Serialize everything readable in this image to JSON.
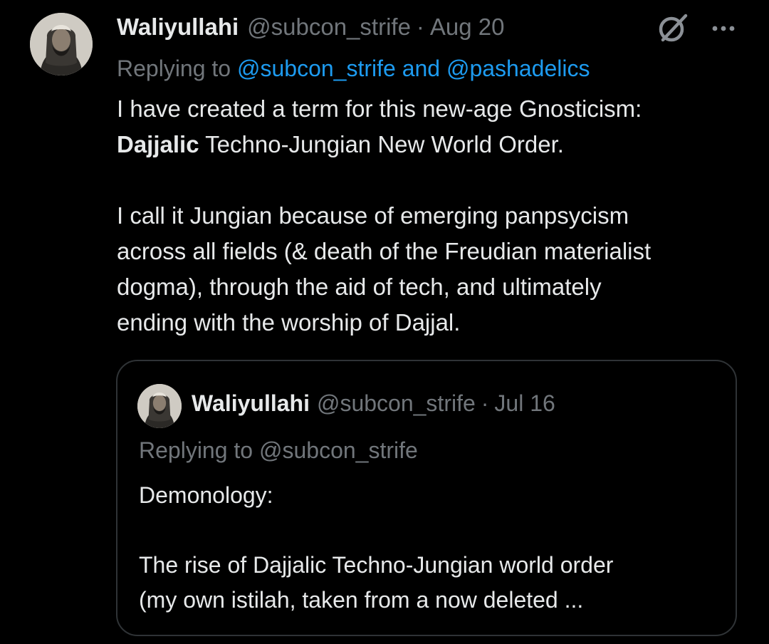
{
  "tweet": {
    "author_name": "Waliyullahi",
    "handle": "@subcon_strife",
    "separator": "·",
    "date": "Aug 20",
    "replying_prefix": "Replying to",
    "replying_user1": "@subcon_strife",
    "replying_and": "and",
    "replying_user2": "@pashadelics",
    "body_line1": "I have created a term for this new-age Gnosticism:",
    "body_line2_bold": "Dajjalic",
    "body_line2_rest": " Techno-Jungian New World Order.",
    "body_line3": "I call it Jungian because of emerging panpsycism",
    "body_line4": "across all fields (& death of the Freudian materialist",
    "body_line5": "dogma), through the aid of tech, and ultimately",
    "body_line6": "ending with the worship of Dajjal."
  },
  "quote": {
    "author_name": "Waliyullahi",
    "handle": "@subcon_strife",
    "separator": "·",
    "date": "Jul 16",
    "replying": "Replying to @subcon_strife",
    "body_line1": "Demonology:",
    "body_line2": "The rise of Dajjalic Techno-Jungian world order",
    "body_line3": "(my own istilah, taken from a now deleted ..."
  },
  "icons": {
    "grok": "grok-icon",
    "more": "more-horizontal-icon",
    "avatar": "avatar-photo"
  },
  "colors": {
    "background": "#000000",
    "text": "#e7e9ea",
    "muted": "#71767b",
    "link": "#1d9bf0",
    "border": "#2f3336"
  }
}
